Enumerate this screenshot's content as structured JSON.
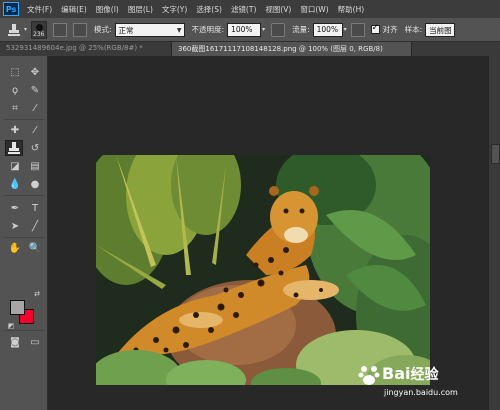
{
  "app": {
    "logo": "Ps"
  },
  "menu": [
    "文件(F)",
    "编辑(E)",
    "图像(I)",
    "图层(L)",
    "文字(Y)",
    "选择(S)",
    "滤镜(T)",
    "视图(V)",
    "窗口(W)",
    "帮助(H)"
  ],
  "options": {
    "brush_size": "236",
    "mode_label": "模式:",
    "mode_value": "正常",
    "opacity_label": "不透明度:",
    "opacity_value": "100%",
    "flow_label": "流量:",
    "flow_value": "100%",
    "aligned_label": "对齐",
    "aligned_checked": true,
    "sample_label": "样本:",
    "sample_value": "当前图"
  },
  "tabs": [
    {
      "label": "532931489604e.jpg @ 25%(RGB/8#) *",
      "active": false
    },
    {
      "label": "360截图16171117108148128.png @ 100% (图层 0, RGB/8)",
      "active": true
    }
  ],
  "colors": {
    "foreground": "#a6a6a6",
    "background": "#f4002a",
    "accent": "#31a8ff"
  },
  "watermark": {
    "brand": "Bai",
    "brand_cn": "经验",
    "url": "jingyan.baidu.com"
  }
}
